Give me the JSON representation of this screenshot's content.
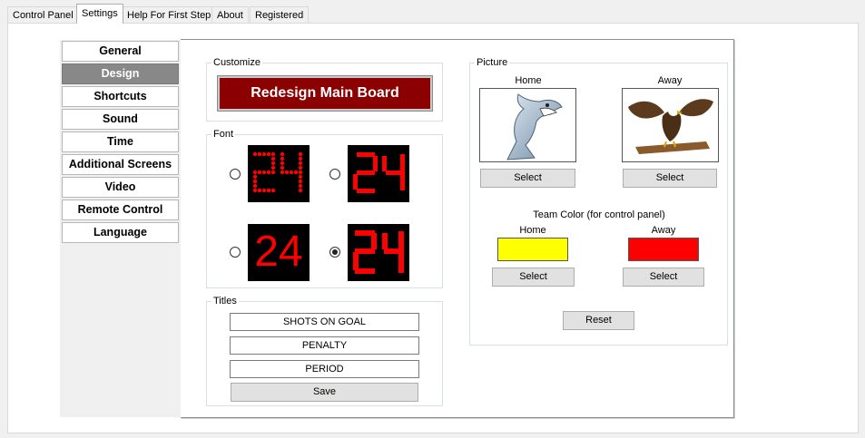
{
  "tabs": [
    {
      "label": "Control Panel"
    },
    {
      "label": "Settings"
    },
    {
      "label": "Help For First Step"
    },
    {
      "label": "About"
    },
    {
      "label": "Registered"
    }
  ],
  "sidebar": {
    "items": [
      {
        "label": "General"
      },
      {
        "label": "Design"
      },
      {
        "label": "Shortcuts"
      },
      {
        "label": "Sound"
      },
      {
        "label": "Time"
      },
      {
        "label": "Additional Screens"
      },
      {
        "label": "Video"
      },
      {
        "label": "Remote Control"
      },
      {
        "label": "Language"
      }
    ],
    "active": "Design"
  },
  "customize": {
    "legend": "Customize",
    "button_label": "Redesign Main Board",
    "button_color": "#8b0000"
  },
  "font": {
    "legend": "Font",
    "options": [
      {
        "sample": "24",
        "style": "dot-matrix",
        "selected": false
      },
      {
        "sample": "24",
        "style": "dot-segment",
        "selected": false
      },
      {
        "sample": "24",
        "style": "sans",
        "selected": false
      },
      {
        "sample": "24",
        "style": "segment",
        "selected": true
      }
    ],
    "digit_color": "#ff0000"
  },
  "titles": {
    "legend": "Titles",
    "values": [
      "SHOTS ON GOAL",
      "PENALTY",
      "PERIOD"
    ],
    "save_label": "Save"
  },
  "picture": {
    "legend": "Picture",
    "home_label": "Home",
    "away_label": "Away",
    "home_image": "shark-icon",
    "away_image": "eagle-icon",
    "select_label": "Select"
  },
  "team_color": {
    "title": "Team Color (for control panel)",
    "home_label": "Home",
    "away_label": "Away",
    "home_color": "#ffff00",
    "away_color": "#ff0000",
    "select_label": "Select"
  },
  "reset_label": "Reset"
}
